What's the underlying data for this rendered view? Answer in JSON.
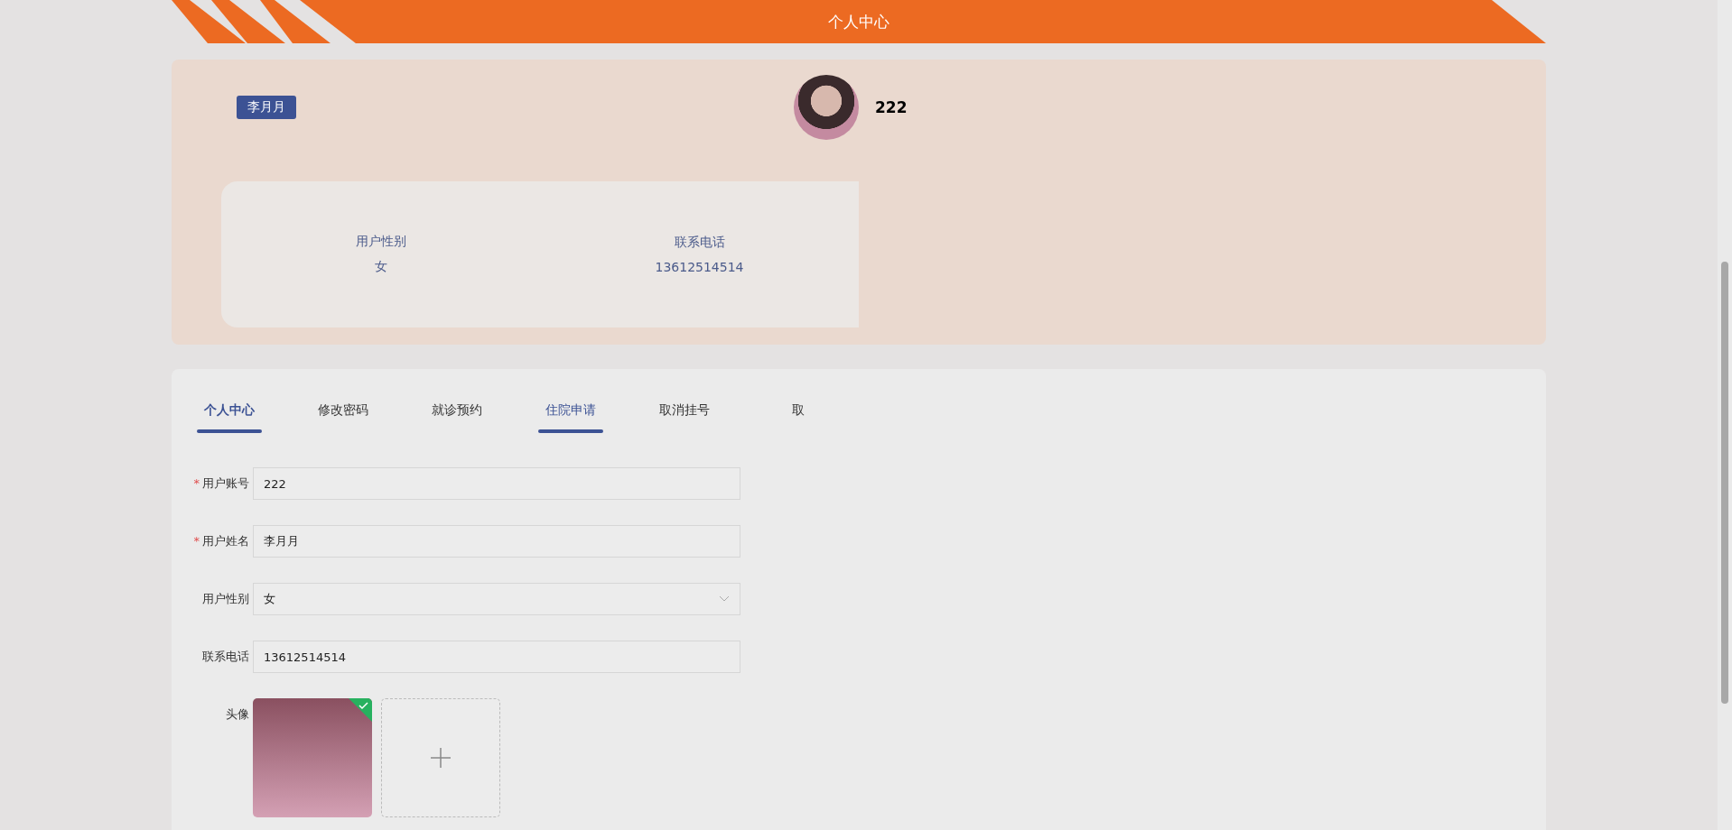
{
  "header": {
    "title": "个人中心"
  },
  "profile": {
    "name_badge": "李月月",
    "username": "222",
    "info": [
      {
        "label": "用户性别",
        "value": "女"
      },
      {
        "label": "联系电话",
        "value": "13612514514"
      }
    ]
  },
  "tabs": [
    {
      "label": "个人中心",
      "selected": true,
      "hovered": false
    },
    {
      "label": "修改密码",
      "selected": false,
      "hovered": false
    },
    {
      "label": "就诊预约",
      "selected": false,
      "hovered": false
    },
    {
      "label": "住院申请",
      "selected": false,
      "hovered": true
    },
    {
      "label": "取消挂号",
      "selected": false,
      "hovered": false
    },
    {
      "label": "取",
      "selected": false,
      "hovered": false
    }
  ],
  "form": {
    "fields": [
      {
        "kind": "text",
        "label": "用户账号",
        "required_mark": "*",
        "value": "222"
      },
      {
        "kind": "text",
        "label": "用户姓名",
        "required_mark": "*",
        "value": "李月月"
      },
      {
        "kind": "select",
        "label": "用户性别",
        "value": "女"
      },
      {
        "kind": "text",
        "label": "联系电话",
        "value": "13612514514"
      },
      {
        "kind": "upload",
        "label": "头像",
        "uploaded": true
      }
    ]
  }
}
